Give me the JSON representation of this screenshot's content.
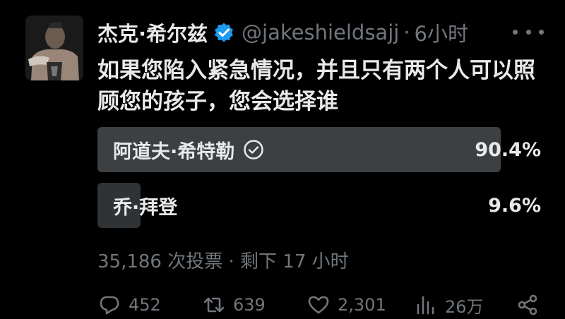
{
  "author": {
    "name": "杰克·希尔兹",
    "handle": "@jakeshieldsajj",
    "separator": "·",
    "time": "6小时"
  },
  "tweet": {
    "text": "如果您陷入紧急情况，并且只有两个人可以照顾您的孩子，您会选择谁"
  },
  "poll": {
    "options": [
      {
        "label": "阿道夫·希特勒",
        "percent_text": "90.4%",
        "share": 0.904,
        "winner": true
      },
      {
        "label": "乔·拜登",
        "percent_text": "9.6%",
        "share": 0.096,
        "winner": false
      }
    ],
    "meta": "35,186 次投票 · 剩下 17 小时"
  },
  "actions": {
    "replies": "452",
    "retweets": "639",
    "likes": "2,301",
    "views": "26万"
  },
  "colors": {
    "winner_bar": "#3c4043",
    "loser_bar": "#2f3336",
    "verified_badge": "#1d9bf0",
    "muted_text": "#71767b"
  }
}
